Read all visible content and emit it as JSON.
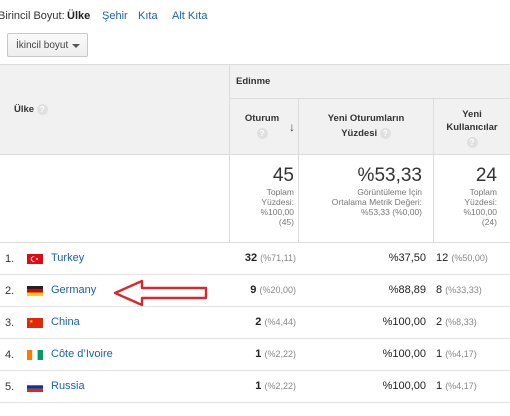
{
  "dimension_bar": {
    "label": "Birincil Boyut:",
    "active": "Ülke",
    "links": [
      "Şehir",
      "Kıta",
      "Alt Kıta"
    ]
  },
  "secondary_dimension_button": "İkincil boyut",
  "table": {
    "group_header": "Edinme",
    "dimension_header": "Ülke",
    "columns": {
      "sessions": "Oturum",
      "new_sessions_line1": "Yeni Oturumların",
      "new_sessions_line2": "Yüzdesi",
      "new_users_line1": "Yeni",
      "new_users_line2": "Kullanıcılar"
    },
    "totals": {
      "sessions": {
        "value": "45",
        "l1": "Toplam",
        "l2": "Yüzdesi:",
        "l3": "%100,00",
        "l4": "(45)"
      },
      "new_sessions": {
        "value": "%53,33",
        "l1": "Görüntüleme İçin",
        "l2": "Ortalama Metrik Değeri:",
        "l3": "%53,33 (%0,00)"
      },
      "new_users": {
        "value": "24",
        "l1": "Toplam",
        "l2": "Yüzdesi:",
        "l3": "%100,00",
        "l4": "(24)"
      }
    },
    "rows": [
      {
        "idx": "1.",
        "country": "Turkey",
        "sessions": "32",
        "sessions_pct": "(%71,11)",
        "new_sessions": "%37,50",
        "new_users": "12",
        "new_users_pct": "(%50,00)"
      },
      {
        "idx": "2.",
        "country": "Germany",
        "sessions": "9",
        "sessions_pct": "(%20,00)",
        "new_sessions": "%88,89",
        "new_users": "8",
        "new_users_pct": "(%33,33)"
      },
      {
        "idx": "3.",
        "country": "China",
        "sessions": "2",
        "sessions_pct": "(%4,44)",
        "new_sessions": "%100,00",
        "new_users": "2",
        "new_users_pct": "(%8,33)"
      },
      {
        "idx": "4.",
        "country": "Côte d’Ivoire",
        "sessions": "1",
        "sessions_pct": "(%2,22)",
        "new_sessions": "%100,00",
        "new_users": "1",
        "new_users_pct": "(%4,17)"
      },
      {
        "idx": "5.",
        "country": "Russia",
        "sessions": "1",
        "sessions_pct": "(%2,22)",
        "new_sessions": "%100,00",
        "new_users": "1",
        "new_users_pct": "(%4,17)"
      }
    ]
  },
  "icons": {
    "help": "question-mark-icon",
    "sort": "arrow-down-icon",
    "annotation": "red-arrow-annotation"
  },
  "colors": {
    "link": "#1a5fb4",
    "annotation_arrow": "#d9272e"
  }
}
